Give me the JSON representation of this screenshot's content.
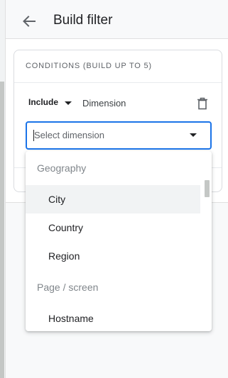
{
  "header": {
    "title": "Build filter",
    "back_icon": "arrow-back-icon"
  },
  "conditions": {
    "heading": "CONDITIONS (BUILD UP TO 5)",
    "include_label": "Include",
    "dimension_label": "Dimension",
    "delete_icon": "trash-icon",
    "select": {
      "placeholder": "Select dimension"
    }
  },
  "dropdown": {
    "groups": [
      {
        "label": "Geography",
        "items": [
          "City",
          "Country",
          "Region"
        ]
      },
      {
        "label": "Page / screen",
        "items": [
          "Hostname"
        ]
      }
    ],
    "highlighted_item": "City"
  },
  "colors": {
    "accent": "#1a73e8",
    "header_bg": "#f8f9fa",
    "muted_text": "#80868b"
  }
}
